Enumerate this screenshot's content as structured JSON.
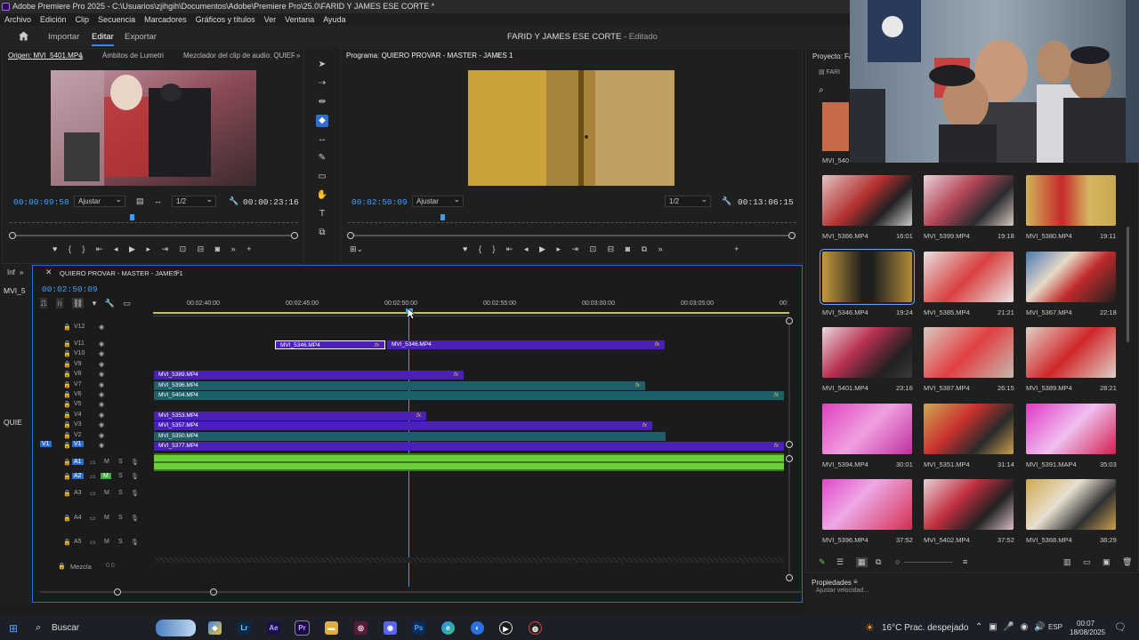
{
  "window": {
    "title": "Adobe Premiere Pro 2025 - C:\\Usuarios\\zjihgih\\Documentos\\Adobe\\Premiere Pro\\25.0\\FARID Y JAMES ESE CORTE *"
  },
  "menu": [
    "Archivo",
    "Edición",
    "Clip",
    "Secuencia",
    "Marcadores",
    "Gráficos y títulos",
    "Ver",
    "Ventana",
    "Ayuda"
  ],
  "header": {
    "import": "Importar",
    "edit": "Editar",
    "export": "Exportar",
    "project": "FARID Y JAMES ESE CORTE",
    "status": "- Editado"
  },
  "source": {
    "tabs": [
      "Origen: MVI_5401.MP4",
      "Ámbitos de Lumetri",
      "Mezclador del clip de audio: QUIERO I"
    ],
    "timecode": "00:00:09:58",
    "fit": "Ajustar",
    "res": "1/2",
    "duration": "00:00:23:16"
  },
  "program": {
    "tab": "Programa: QUIERO PROVAR - MASTER - JAMES 1",
    "timecode": "00:02:50:09",
    "fit": "Ajustar",
    "res": "1/2",
    "duration": "00:13:06:15"
  },
  "timeline": {
    "tab": "QUIERO PROVAR - MASTER - JAMES 1",
    "timecode": "00:02:50:09",
    "side_tab": "Inf",
    "side_label": "MVI_5",
    "side_label2": "QUIE",
    "ruler": [
      "00:02:40:00",
      "00:02:45:00",
      "00:02:50:00",
      "00:02:55:00",
      "00:03:00:00",
      "00:03:05:00",
      "00:"
    ],
    "video_tracks": [
      "V12",
      "V11",
      "V10",
      "V9",
      "V8",
      "V7",
      "V6",
      "V5",
      "V4",
      "V3",
      "V2",
      "V1"
    ],
    "audio_tracks": [
      "A1",
      "A2",
      "A3",
      "A4",
      "A5"
    ],
    "mix": "Mezcla",
    "mix_val": "0.0",
    "clips": [
      "MVI_5346.MP4",
      "MVI_5346.MP4",
      "MVI_5389.MP4",
      "MVI_5396.MP4",
      "MVI_5404.MP4",
      "MVI_5353.MP4",
      "MVI_5357.MP4",
      "MVI_5350.MP4",
      "MVI_5377.MP4"
    ]
  },
  "project": {
    "tab": "Proyecto: FA",
    "folder": "FARI",
    "first_label": "MVI_540",
    "items": [
      {
        "name": "MVI_5366.MP4",
        "dur": "16:01"
      },
      {
        "name": "MVI_5399.MP4",
        "dur": "19:18"
      },
      {
        "name": "MVI_5380.MP4",
        "dur": "19:11"
      },
      {
        "name": "MVI_5346.MP4",
        "dur": "19:24"
      },
      {
        "name": "MVI_5385.MP4",
        "dur": "21:21"
      },
      {
        "name": "MVI_5367.MP4",
        "dur": "22:18"
      },
      {
        "name": "MVI_5401.MP4",
        "dur": "23:16"
      },
      {
        "name": "MVI_5387.MP4",
        "dur": "26:15"
      },
      {
        "name": "MVI_5389.MP4",
        "dur": "28:21"
      },
      {
        "name": "MVI_5394.MP4",
        "dur": "30:01"
      },
      {
        "name": "MVI_5351.MP4",
        "dur": "31:14"
      },
      {
        "name": "MVI_5391.MAP4",
        "dur": "35:03"
      },
      {
        "name": "MVI_5396.MP4",
        "dur": "37:52"
      },
      {
        "name": "MVI_5402.MP4",
        "dur": "37:52"
      },
      {
        "name": "MVI_5368.MP4",
        "dur": "38:29"
      }
    ]
  },
  "properties": {
    "tab": "Propiedades",
    "sub": "Ajustar velocidad..."
  },
  "taskbar": {
    "search": "Buscar",
    "weather": "16°C Prac. despejado",
    "lang": "ESP",
    "time": "00:07",
    "date": "18/08/2025"
  },
  "colors": {
    "accent": "#2d8ceb",
    "clip_violet": "#4a20b8",
    "clip_teal": "#1e5f6a",
    "audio": "#6bcf3a"
  }
}
